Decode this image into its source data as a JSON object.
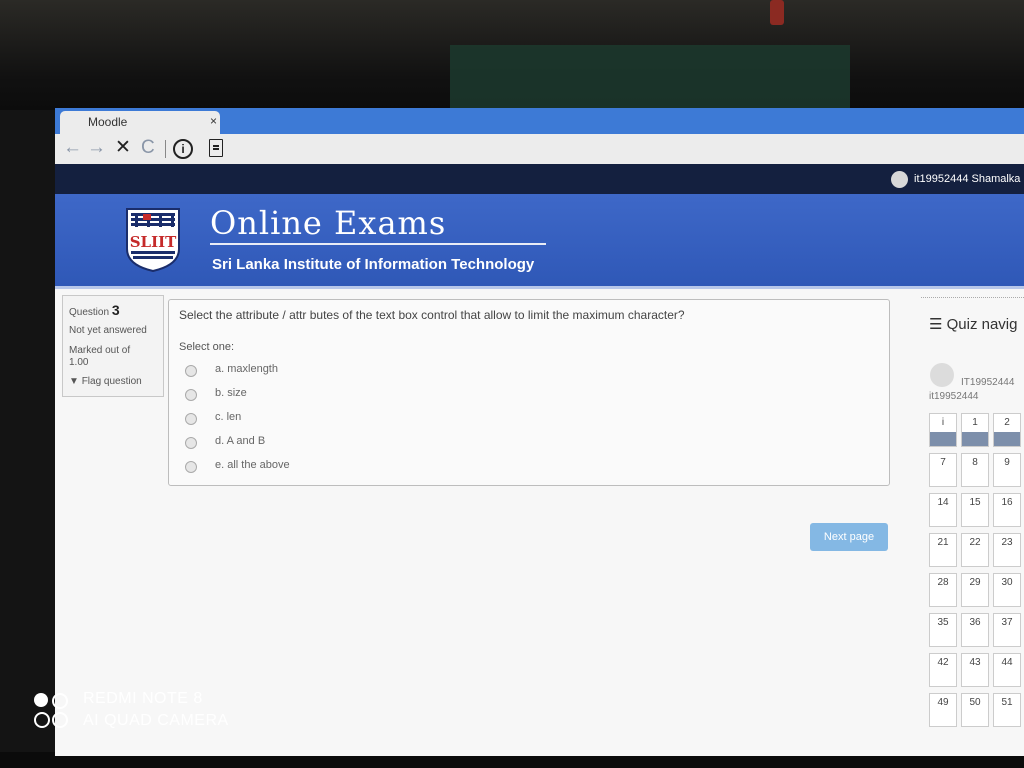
{
  "browser": {
    "tab_title": "Moodle",
    "tab_close": "×",
    "nav": {
      "back": "←",
      "forward": "→",
      "stop": "✕",
      "reload": "C",
      "info": "i"
    }
  },
  "header": {
    "user_label": "it19952444 Shamalka"
  },
  "banner": {
    "logo_text": "SLIIT",
    "title": "Online Exams",
    "subtitle": "Sri Lanka Institute of Information Technology"
  },
  "question_info": {
    "label": "Question",
    "number": "3",
    "state": "Not yet answered",
    "mark_label": "Marked out of",
    "mark_value": "1.00",
    "flag_label": "Flag question"
  },
  "question": {
    "text": "Select the attribute / attr butes of the text box control that allow to limit the maximum character?",
    "prompt": "Select one:",
    "options": [
      {
        "label": "a. maxlength"
      },
      {
        "label": "b. size"
      },
      {
        "label": "c. len"
      },
      {
        "label": "d. A and B"
      },
      {
        "label": "e. all the above"
      }
    ],
    "next_button": "Next page"
  },
  "quiz_nav": {
    "title": "☰ Quiz navig",
    "user_line1": "IT19952444",
    "user_line2": "it19952444",
    "buttons": [
      "i",
      "1",
      "2",
      "7",
      "8",
      "9",
      "14",
      "15",
      "16",
      "21",
      "22",
      "23",
      "28",
      "29",
      "30",
      "35",
      "36",
      "37",
      "42",
      "43",
      "44",
      "49",
      "50",
      "51"
    ],
    "answered": [
      "i",
      "1",
      "2"
    ]
  },
  "watermark": {
    "line1": "REDMI NOTE 8",
    "line2": "AI QUAD CAMERA"
  },
  "colors": {
    "tab_bar": "#3d7ad6",
    "top_nav": "#14203f",
    "banner": "#2f58b7",
    "next_button": "#84b8e4",
    "answered_slot": "#7d8fab"
  },
  "icons": [
    "back-icon",
    "forward-icon",
    "stop-icon",
    "reload-icon",
    "info-icon",
    "page-icon",
    "hamburger-icon",
    "flag-icon"
  ]
}
